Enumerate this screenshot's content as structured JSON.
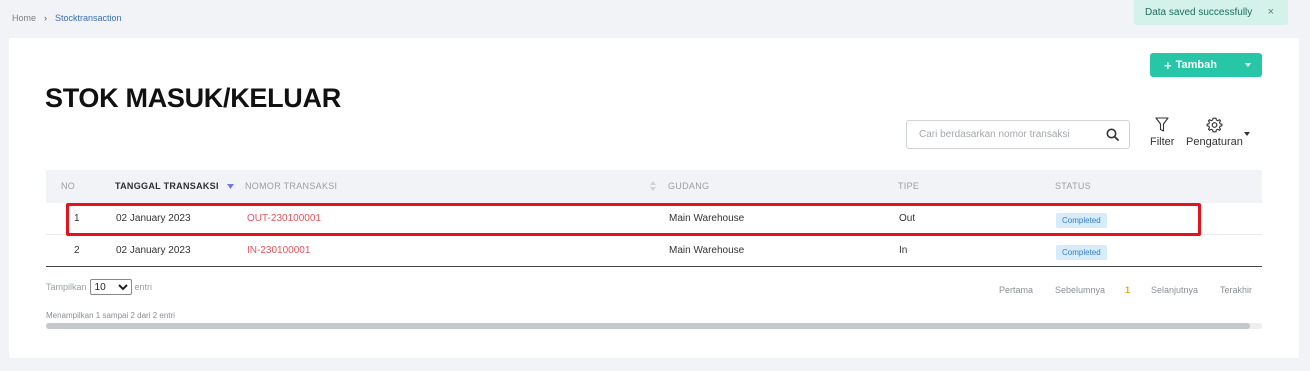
{
  "breadcrumb": {
    "home": "Home",
    "separator": "›",
    "current": "Stocktransaction"
  },
  "toast": {
    "message": "Data saved successfully",
    "close": "×"
  },
  "toolbar": {
    "add_label": "Tambah",
    "add_icon": "+"
  },
  "page": {
    "title": "STOK MASUK/KELUAR"
  },
  "search": {
    "placeholder": "Cari berdasarkan nomor transaksi"
  },
  "tools": {
    "filter_label": "Filter",
    "settings_label": "Pengaturan"
  },
  "table": {
    "headers": {
      "no": "NO",
      "date": "TANGGAL TRANSAKSI",
      "number": "NOMOR TRANSAKSI",
      "warehouse": "GUDANG",
      "type": "TIPE",
      "status": "STATUS"
    },
    "rows": [
      {
        "no": "1",
        "date": "02 January 2023",
        "number": "OUT-230100001",
        "warehouse": "Main Warehouse",
        "type": "Out",
        "status": "Completed"
      },
      {
        "no": "2",
        "date": "02 January 2023",
        "number": "IN-230100001",
        "warehouse": "Main Warehouse",
        "type": "In",
        "status": "Completed"
      }
    ]
  },
  "footer": {
    "show_label": "Tampilkan",
    "page_size": "10",
    "entries_label": "entri",
    "info": "Menampilkan 1 sampai 2 dari 2 entri"
  },
  "pagination": {
    "first": "Pertama",
    "prev": "Sebelumnya",
    "current": "1",
    "next": "Selanjutnya",
    "last": "Terakhir"
  },
  "colors": {
    "accent": "#26c6a6",
    "link_red": "#e5545c",
    "highlight": "#e3131b",
    "page_current": "#f0a41c"
  }
}
